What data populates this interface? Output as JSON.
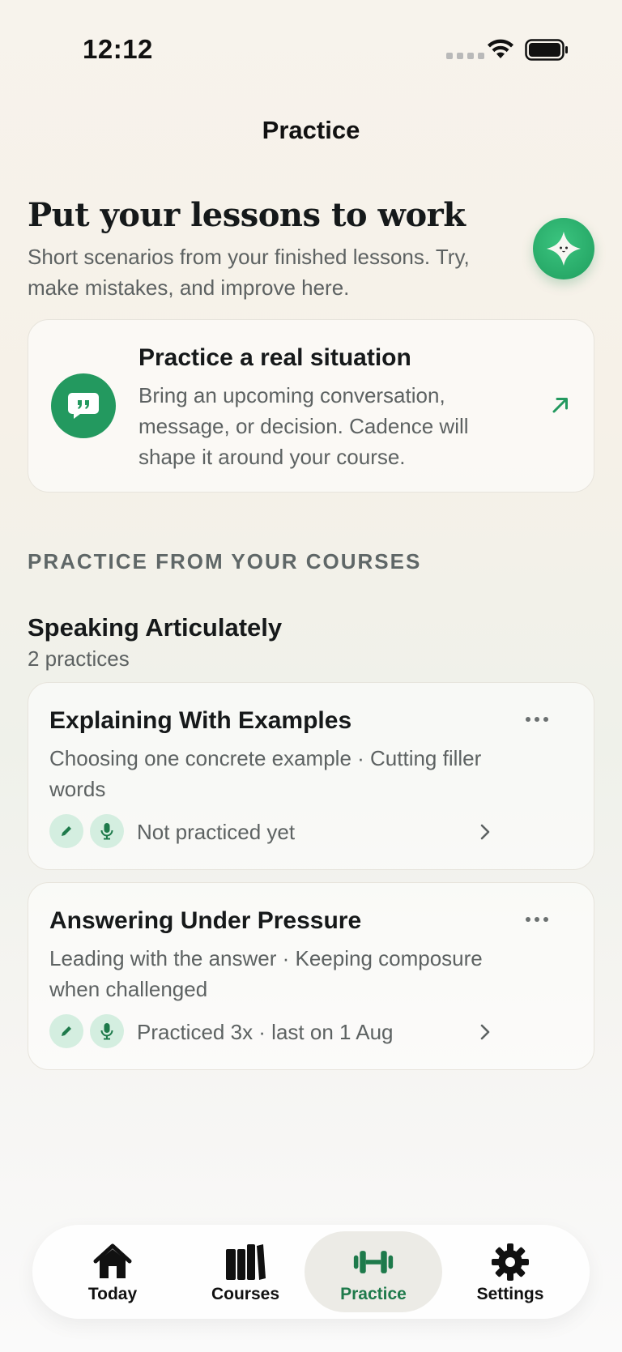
{
  "status_bar": {
    "time": "12:12"
  },
  "nav": {
    "title": "Practice"
  },
  "hero": {
    "title": "Put your lessons to work",
    "subtitle": "Short scenarios from your finished lessons. Try, make mistakes, and improve here."
  },
  "situation_card": {
    "title": "Practice a real situation",
    "description": "Bring an upcoming conversation, message, or decision. Cadence will shape it around your course."
  },
  "section": {
    "header": "PRACTICE FROM YOUR COURSES"
  },
  "course": {
    "name": "Speaking Articulately",
    "count": "2 practices"
  },
  "practices": [
    {
      "title": "Explaining With Examples",
      "description": "Choosing one concrete example · Cutting filler words",
      "status": "Not practiced yet"
    },
    {
      "title": "Answering Under Pressure",
      "description": "Leading with the answer · Keeping composure when challenged",
      "status": "Practiced 3x · last on 1 Aug"
    }
  ],
  "tabbar": {
    "tabs": [
      {
        "label": "Today",
        "icon": "house-icon"
      },
      {
        "label": "Courses",
        "icon": "books-icon"
      },
      {
        "label": "Practice",
        "icon": "dumbbell-icon",
        "active": true
      },
      {
        "label": "Settings",
        "icon": "gear-icon"
      }
    ]
  },
  "colors": {
    "accent": "#23995f",
    "active_tab_text": "#1e7a4b",
    "badge_bg": "#d4eee0"
  }
}
